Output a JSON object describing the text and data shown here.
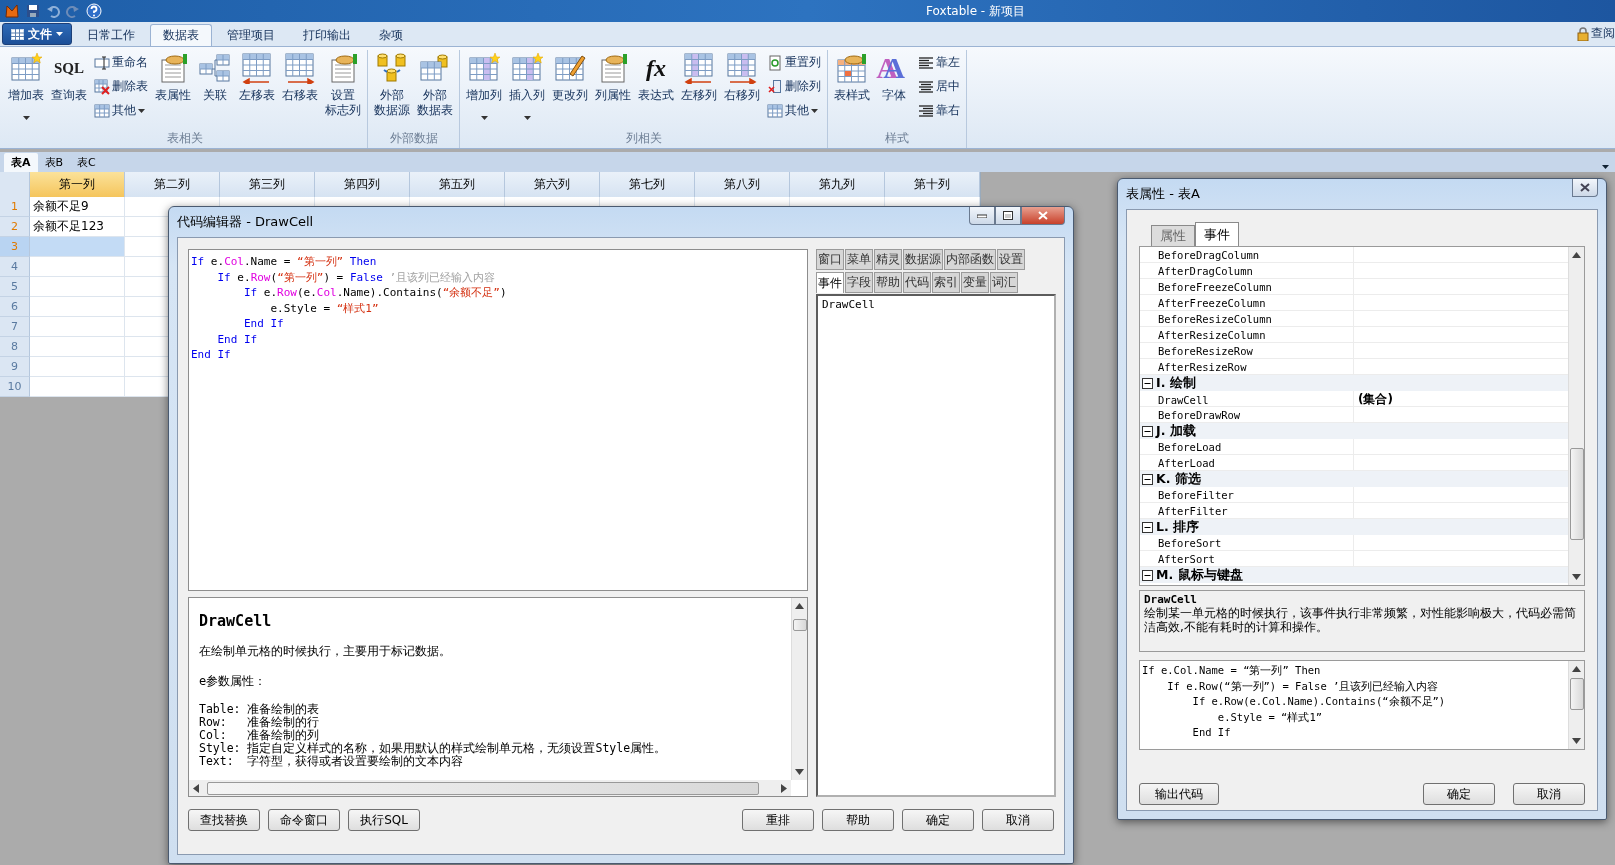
{
  "app_title": "Foxtable - 新项目",
  "ribbon": {
    "file_menu": "文件",
    "lock_label": "查阅",
    "tabs": [
      {
        "label": "日常工作",
        "selected": false
      },
      {
        "label": "数据表",
        "selected": true
      },
      {
        "label": "管理项目",
        "selected": false
      },
      {
        "label": "打印输出",
        "selected": false
      },
      {
        "label": "杂项",
        "selected": false
      }
    ],
    "groups": [
      {
        "title": "表相关",
        "items": [
          {
            "kind": "large",
            "lines": [
              "增加表"
            ],
            "dropdown": true
          },
          {
            "kind": "large",
            "lines": [
              "查询表"
            ],
            "icon_text": "SQL",
            "dropdown": false
          },
          {
            "kind": "stack",
            "entries": [
              {
                "label": "重命名",
                "dropdown": false
              },
              {
                "label": "删除表",
                "dropdown": false
              },
              {
                "label": "其他",
                "dropdown": true
              }
            ]
          },
          {
            "kind": "large",
            "lines": [
              "表属性"
            ],
            "dropdown": false
          },
          {
            "kind": "large",
            "lines": [
              "关联"
            ],
            "dropdown": false
          },
          {
            "kind": "large",
            "lines": [
              "左移表"
            ],
            "dropdown": false
          },
          {
            "kind": "large",
            "lines": [
              "右移表"
            ],
            "dropdown": false
          },
          {
            "kind": "large",
            "lines": [
              "设置",
              "标志列"
            ],
            "dropdown": false
          }
        ]
      },
      {
        "title": "外部数据",
        "items": [
          {
            "kind": "large",
            "lines": [
              "外部",
              "数据源"
            ],
            "dropdown": false
          },
          {
            "kind": "large",
            "lines": [
              "外部",
              "数据表"
            ],
            "dropdown": false
          }
        ]
      },
      {
        "title": "列相关",
        "items": [
          {
            "kind": "large",
            "lines": [
              "增加列"
            ],
            "dropdown": true
          },
          {
            "kind": "large",
            "lines": [
              "插入列"
            ],
            "dropdown": true
          },
          {
            "kind": "large",
            "lines": [
              "更改列"
            ],
            "dropdown": false
          },
          {
            "kind": "large",
            "lines": [
              "列属性"
            ],
            "dropdown": false
          },
          {
            "kind": "large",
            "lines": [
              "表达式"
            ],
            "icon_text": "fx",
            "dropdown": false
          },
          {
            "kind": "large",
            "lines": [
              "左移列"
            ],
            "dropdown": false
          },
          {
            "kind": "large",
            "lines": [
              "右移列"
            ],
            "dropdown": false
          },
          {
            "kind": "stack",
            "entries": [
              {
                "label": "重置列",
                "dropdown": false
              },
              {
                "label": "删除列",
                "dropdown": false
              },
              {
                "label": "其他",
                "dropdown": true
              }
            ]
          }
        ]
      },
      {
        "title": "样式",
        "items": [
          {
            "kind": "large",
            "lines": [
              "表样式"
            ],
            "dropdown": false
          },
          {
            "kind": "large",
            "lines": [
              "字体"
            ],
            "icon_text": "A",
            "dropdown": false
          },
          {
            "kind": "stack",
            "entries": [
              {
                "label": "靠左",
                "dropdown": false
              },
              {
                "label": "居中",
                "dropdown": false
              },
              {
                "label": "靠右",
                "dropdown": false
              }
            ]
          }
        ]
      }
    ]
  },
  "sheet_tabs": [
    {
      "label": "表A",
      "selected": true
    },
    {
      "label": "表B",
      "selected": false
    },
    {
      "label": "表C",
      "selected": false
    }
  ],
  "grid": {
    "columns": [
      {
        "label": "第一列",
        "selected": true
      },
      {
        "label": "第二列",
        "selected": false
      },
      {
        "label": "第三列",
        "selected": false
      },
      {
        "label": "第四列",
        "selected": false
      },
      {
        "label": "第五列",
        "selected": false
      },
      {
        "label": "第六列",
        "selected": false
      },
      {
        "label": "第七列",
        "selected": false
      },
      {
        "label": "第八列",
        "selected": false
      },
      {
        "label": "第九列",
        "selected": false
      },
      {
        "label": "第十列",
        "selected": false
      }
    ],
    "rows": [
      {
        "number": "1",
        "value": "余额不足9",
        "selected": false
      },
      {
        "number": "2",
        "value": "余额不足123",
        "selected": false
      },
      {
        "number": "3",
        "selected": true
      },
      {
        "number": "4",
        "selected": false
      },
      {
        "number": "5",
        "selected": false
      },
      {
        "number": "6",
        "selected": false
      },
      {
        "number": "7",
        "selected": false
      },
      {
        "number": "8",
        "selected": false
      },
      {
        "number": "9",
        "selected": false
      },
      {
        "number": "10",
        "selected": false
      }
    ]
  },
  "code_editor": {
    "title": "代码编辑器 - DrawCell",
    "code_lines": [
      [
        {
          "kind": "keyword",
          "text": "If"
        },
        {
          "kind": "plain",
          "text": " e."
        },
        {
          "kind": "member",
          "text": "Col"
        },
        {
          "kind": "plain",
          "text": ".Name = "
        },
        {
          "kind": "string",
          "text": "“第一列”"
        },
        {
          "kind": "keyword",
          "text": " Then"
        }
      ],
      [
        {
          "kind": "keyword",
          "text": "    If"
        },
        {
          "kind": "plain",
          "text": " e."
        },
        {
          "kind": "member",
          "text": "Row"
        },
        {
          "kind": "plain",
          "text": "("
        },
        {
          "kind": "string",
          "text": "“第一列”"
        },
        {
          "kind": "plain",
          "text": ") = "
        },
        {
          "kind": "keyword",
          "text": "False"
        },
        {
          "kind": "comment",
          "text": " ’且该列已经输入内容"
        }
      ],
      [
        {
          "kind": "keyword",
          "text": "        If"
        },
        {
          "kind": "plain",
          "text": " e."
        },
        {
          "kind": "member",
          "text": "Row"
        },
        {
          "kind": "plain",
          "text": "(e."
        },
        {
          "kind": "member",
          "text": "Col"
        },
        {
          "kind": "plain",
          "text": ".Name).Contains("
        },
        {
          "kind": "string",
          "text": "“余额不足”"
        },
        {
          "kind": "plain",
          "text": ")"
        }
      ],
      [
        {
          "kind": "plain",
          "text": "            e.Style = "
        },
        {
          "kind": "string",
          "text": "“样式1”"
        }
      ],
      [
        {
          "kind": "keyword",
          "text": "        End If"
        }
      ],
      [
        {
          "kind": "keyword",
          "text": "    End If"
        }
      ],
      [
        {
          "kind": "keyword",
          "text": "End If"
        }
      ]
    ],
    "side_tabs_top": [
      {
        "label": "窗口",
        "selected": false
      },
      {
        "label": "菜单",
        "selected": false
      },
      {
        "label": "精灵",
        "selected": false
      },
      {
        "label": "数据源",
        "selected": false
      },
      {
        "label": "内部函数",
        "selected": false
      },
      {
        "label": "设置",
        "selected": false
      }
    ],
    "side_tabs_bottom": [
      {
        "label": "事件",
        "selected": true
      },
      {
        "label": "字段",
        "selected": false
      },
      {
        "label": "帮助",
        "selected": false
      },
      {
        "label": "代码",
        "selected": false
      },
      {
        "label": "索引",
        "selected": false
      },
      {
        "label": "变量",
        "selected": false
      },
      {
        "label": "词汇",
        "selected": false
      }
    ],
    "events": [
      "DrawCell"
    ],
    "help": {
      "heading": "DrawCell",
      "intro": "在绘制单元格的时候执行，主要用于标记数据。",
      "params_title": "e参数属性：",
      "params": [
        "Table: 准备绘制的表",
        "Row:   准备绘制的行",
        "Col:   准备绘制的列",
        "Style: 指定自定义样式的名称，如果用默认的样式绘制单元格，无须设置Style属性。",
        "Text:  字符型，获得或者设置要绘制的文本内容"
      ]
    },
    "buttons_left": [
      "查找替换",
      "命令窗口",
      "执行SQL"
    ],
    "buttons_right": [
      "重排",
      "帮助",
      "确定",
      "取消"
    ]
  },
  "properties_window": {
    "title": "表属性 - 表A",
    "tabs": [
      {
        "label": "属性",
        "selected": false
      },
      {
        "label": "事件",
        "selected": true
      }
    ],
    "items": [
      {
        "kind": "row",
        "name": "BeforeDragColumn"
      },
      {
        "kind": "row",
        "name": "AfterDragColumn"
      },
      {
        "kind": "row",
        "name": "BeforeFreezeColumn"
      },
      {
        "kind": "row",
        "name": "AfterFreezeColumn"
      },
      {
        "kind": "row",
        "name": "BeforeResizeColumn"
      },
      {
        "kind": "row",
        "name": "AfterResizeColumn"
      },
      {
        "kind": "row",
        "name": "BeforeResizeRow"
      },
      {
        "kind": "row",
        "name": "AfterResizeRow"
      },
      {
        "kind": "category",
        "label": "I. 绘制",
        "expanded": true,
        "children": [
          {
            "kind": "row",
            "name": "DrawCell",
            "value": "(集合)"
          },
          {
            "kind": "row",
            "name": "BeforeDrawRow"
          }
        ]
      },
      {
        "kind": "category",
        "label": "J. 加载",
        "expanded": true,
        "children": [
          {
            "kind": "row",
            "name": "BeforeLoad"
          },
          {
            "kind": "row",
            "name": "AfterLoad"
          }
        ]
      },
      {
        "kind": "category",
        "label": "K. 筛选",
        "expanded": true,
        "children": [
          {
            "kind": "row",
            "name": "BeforeFilter"
          },
          {
            "kind": "row",
            "name": "AfterFilter"
          }
        ]
      },
      {
        "kind": "category",
        "label": "L. 排序",
        "expanded": true,
        "children": [
          {
            "kind": "row",
            "name": "BeforeSort"
          },
          {
            "kind": "row",
            "name": "AfterSort"
          }
        ]
      },
      {
        "kind": "category",
        "label": "M. 鼠标与键盘",
        "expanded": true
      }
    ],
    "description": {
      "title": "DrawCell",
      "text": "绘制某一单元格的时候执行，该事件执行非常频繁，对性能影响极大，代码必需简洁高效,不能有耗时的计算和操作。"
    },
    "code_preview": [
      "If e.Col.Name = “第一列” Then",
      "    If e.Row(“第一列”) = False ’且该列已经输入内容",
      "        If e.Row(e.Col.Name).Contains(“余额不足”)",
      "            e.Style = “样式1”",
      "        End If"
    ],
    "buttons_left": [
      "输出代码"
    ],
    "buttons_right": [
      "确定",
      "取消"
    ]
  }
}
